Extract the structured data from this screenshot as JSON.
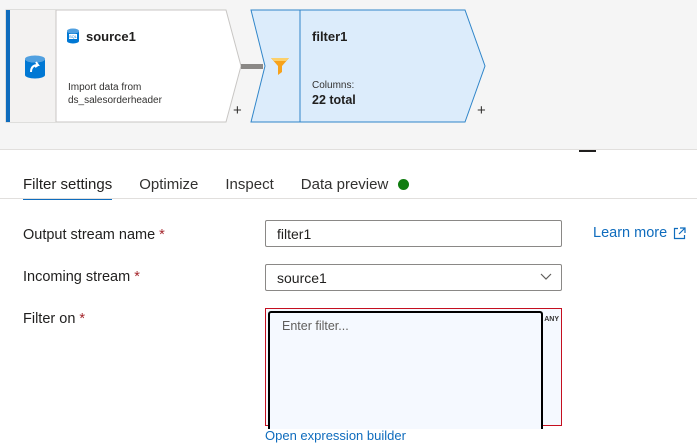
{
  "canvas": {
    "source_node": {
      "title": "source1",
      "description_line1": "Import data from",
      "description_line2": "ds_salesorderheader",
      "icon": "sql-database-icon",
      "add_label": "+"
    },
    "filter_node": {
      "title": "filter1",
      "columns_label": "Columns:",
      "columns_value": "22 total",
      "icon": "funnel-icon",
      "add_label": "+"
    }
  },
  "tabs": [
    {
      "label": "Filter settings",
      "active": true
    },
    {
      "label": "Optimize",
      "active": false
    },
    {
      "label": "Inspect",
      "active": false
    },
    {
      "label": "Data preview",
      "active": false,
      "status": "green-dot"
    }
  ],
  "form": {
    "output_stream": {
      "label": "Output stream name",
      "required": "*",
      "value": "filter1"
    },
    "incoming_stream": {
      "label": "Incoming stream",
      "required": "*",
      "value": "source1"
    },
    "filter_on": {
      "label": "Filter on",
      "required": "*",
      "placeholder": "Enter filter...",
      "badge": "ANY"
    },
    "learn_more": "Learn more",
    "open_expression_builder": "Open expression builder"
  },
  "colors": {
    "accent": "#0f6cbd",
    "node_selected_fill": "#dcecfb",
    "node_selected_border": "#2f85c9",
    "required": "#a4262c",
    "status_green": "#107c10",
    "error_border": "#c50f1f"
  }
}
